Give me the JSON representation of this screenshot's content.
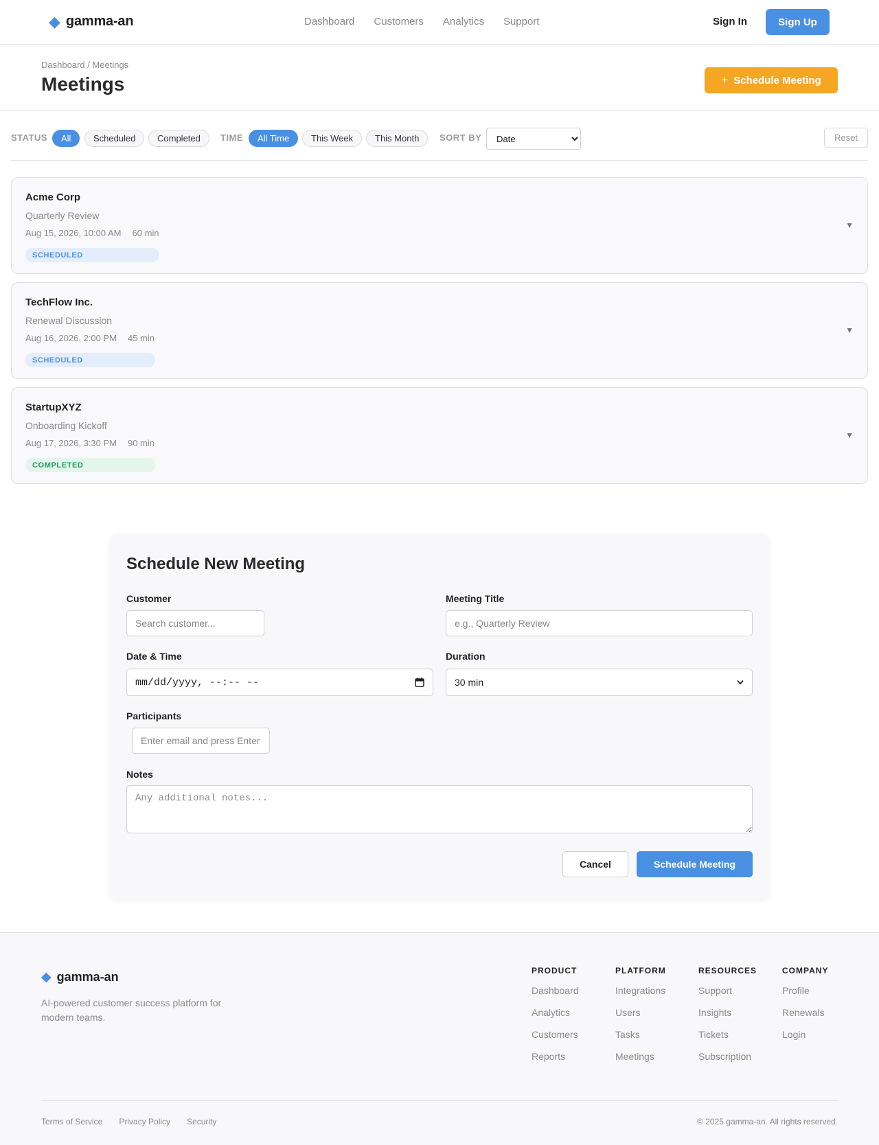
{
  "header": {
    "brand": "gamma-an",
    "nav": [
      "Dashboard",
      "Customers",
      "Analytics",
      "Support"
    ],
    "sign_in": "Sign In",
    "sign_up": "Sign Up"
  },
  "page": {
    "breadcrumb": "Dashboard / Meetings",
    "title": "Meetings",
    "schedule_button": "Schedule Meeting"
  },
  "filters": {
    "status_label": "STATUS",
    "status_options": [
      "All",
      "Scheduled",
      "Completed"
    ],
    "time_label": "TIME",
    "time_options": [
      "All Time",
      "This Week",
      "This Month"
    ],
    "sort_label": "SORT BY",
    "sort_value": "Date",
    "reset": "Reset"
  },
  "meetings": [
    {
      "customer": "Acme Corp",
      "title": "Quarterly Review",
      "datetime": "Aug 15, 2026, 10:00 AM",
      "duration": "60 min",
      "status": "SCHEDULED"
    },
    {
      "customer": "TechFlow Inc.",
      "title": "Renewal Discussion",
      "datetime": "Aug 16, 2026, 2:00 PM",
      "duration": "45 min",
      "status": "SCHEDULED"
    },
    {
      "customer": "StartupXYZ",
      "title": "Onboarding Kickoff",
      "datetime": "Aug 17, 2026, 3:30 PM",
      "duration": "90 min",
      "status": "COMPLETED"
    }
  ],
  "form": {
    "title": "Schedule New Meeting",
    "customer_label": "Customer",
    "customer_placeholder": "Search customer...",
    "meeting_title_label": "Meeting Title",
    "meeting_title_placeholder": "e.g., Quarterly Review",
    "datetime_label": "Date & Time",
    "datetime_value": "mm/dd/yyyy, --:-- --",
    "duration_label": "Duration",
    "duration_value": "30 min",
    "participants_label": "Participants",
    "participants_placeholder": "Enter email and press Enter",
    "notes_label": "Notes",
    "notes_placeholder": "Any additional notes...",
    "cancel": "Cancel",
    "submit": "Schedule Meeting"
  },
  "footer": {
    "brand": "gamma-an",
    "tagline": "AI-powered customer success platform for modern teams.",
    "columns": [
      {
        "heading": "PRODUCT",
        "links": [
          "Dashboard",
          "Analytics",
          "Customers",
          "Reports"
        ]
      },
      {
        "heading": "PLATFORM",
        "links": [
          "Integrations",
          "Users",
          "Tasks",
          "Meetings"
        ]
      },
      {
        "heading": "RESOURCES",
        "links": [
          "Support",
          "Insights",
          "Tickets",
          "Subscription"
        ]
      },
      {
        "heading": "COMPANY",
        "links": [
          "Profile",
          "Renewals",
          "Login"
        ]
      }
    ],
    "legal": [
      "Terms of Service",
      "Privacy Policy",
      "Security"
    ],
    "copyright": "© 2025 gamma-an. All rights reserved."
  },
  "colors": {
    "primary": "#4a90e2",
    "accent": "#f5a623",
    "completed": "#1e9a5c"
  },
  "icons": {
    "brand": "diamond-icon",
    "add": "plus-icon",
    "expand": "chevron-down-icon",
    "calendar": "calendar-icon"
  }
}
